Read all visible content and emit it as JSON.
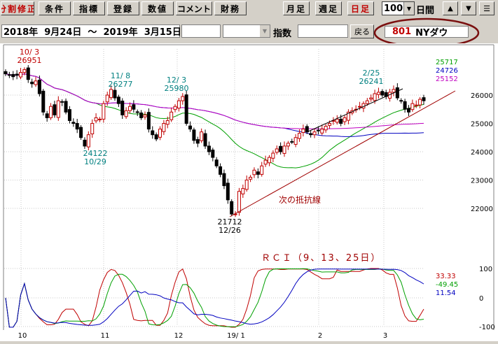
{
  "toolbar": {
    "buttons": [
      {
        "label": "分割修正",
        "color": "red"
      },
      {
        "label": "条件"
      },
      {
        "label": "指標"
      },
      {
        "label": "登録"
      },
      {
        "label": "数値"
      },
      {
        "label": "コメント"
      },
      {
        "label": "財務"
      },
      {
        "label": "月足"
      },
      {
        "label": "週足"
      },
      {
        "label": "日足",
        "color": "red"
      }
    ],
    "count_value": "100",
    "period_label": "日間",
    "up_button": "▲",
    "down_button": "▼",
    "menu_button": "☰"
  },
  "datebar": {
    "date_range": "2018年  9月24日  〜  2019年  3月15日",
    "index_label": "指数",
    "back_button": "戻る",
    "code": "801",
    "name": "NYダウ"
  },
  "chart_data": {
    "type": "candlestick",
    "y_axis_ticks": [
      "26000",
      "25000",
      "24000",
      "23000",
      "22000"
    ],
    "x_axis_ticks": [
      "10",
      "11",
      "12",
      "19/ 1",
      "2",
      "3"
    ],
    "ma_values": [
      {
        "value": "25717",
        "color": "#00a000"
      },
      {
        "value": "24726",
        "color": "#0000c0"
      },
      {
        "value": "25152",
        "color": "#c000c0"
      }
    ],
    "annotations": [
      {
        "date": "10/ 3",
        "value": "26951",
        "color": "#c00000"
      },
      {
        "date": "11/ 8",
        "value": "26277",
        "color": "#008080"
      },
      {
        "date": "12/ 3",
        "value": "25980",
        "color": "#008080"
      },
      {
        "date": "2/25",
        "value": "26241",
        "color": "#008080"
      },
      {
        "value": "24122",
        "date": "10/29",
        "color": "#008080"
      },
      {
        "value": "21712",
        "date": "12/26",
        "color": "#000000"
      }
    ],
    "trendline_label": "次の抵抗線",
    "closes": [
      26750,
      26700,
      26650,
      26700,
      26800,
      26900,
      26550,
      26400,
      26500,
      26050,
      25400,
      25200,
      25600,
      25300,
      25800,
      25750,
      25400,
      25100,
      25000,
      24800,
      24500,
      24200,
      24600,
      25000,
      25200,
      25150,
      25700,
      26000,
      26200,
      25900,
      25700,
      25300,
      25450,
      25600,
      25500,
      25400,
      25200,
      25300,
      24800,
      24600,
      24450,
      24800,
      25000,
      25100,
      25400,
      25600,
      25800,
      25950,
      25000,
      24800,
      24400,
      24300,
      24700,
      24200,
      24000,
      23800,
      23500,
      23200,
      22800,
      22300,
      21800,
      21800,
      22600,
      22700,
      23000,
      23100,
      23350,
      23200,
      23500,
      23700,
      23800,
      23950,
      24100,
      24000,
      24200,
      24300,
      24350,
      24500,
      24650,
      24800,
      24700,
      24600,
      24700,
      24750,
      24800,
      24900,
      25000,
      25100,
      25150,
      25000,
      25200,
      25400,
      25450,
      25500,
      25600,
      25700,
      25800,
      25900,
      26050,
      26100,
      26000,
      25950,
      26100,
      26200,
      25900,
      25800,
      25500,
      25400,
      25700,
      25650,
      25850,
      25800
    ],
    "rci": {
      "title": "ＲＣＩ（9、13、25日）",
      "ticks": [
        "100",
        "0",
        "-100"
      ],
      "values": [
        {
          "value": "33.33",
          "color": "#c00000"
        },
        {
          "value": "-49.45",
          "color": "#00a000"
        },
        {
          "value": "11.54",
          "color": "#0000c0"
        }
      ]
    }
  }
}
